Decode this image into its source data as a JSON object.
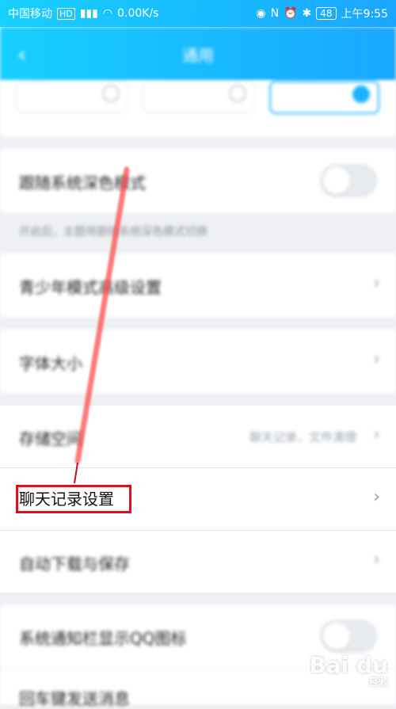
{
  "status_bar": {
    "carrier": "中国移动",
    "hd": "HD",
    "speed": "0.00K/s",
    "battery": "48",
    "time": "上午9:55"
  },
  "header": {
    "title": "通用",
    "back_icon": "chevron-left-icon"
  },
  "settings": {
    "dark_mode_follow": {
      "label": "跟随系统深色模式"
    },
    "dark_mode_hint": "开启后，主题将跟随系统深色模式切换",
    "youth_mode": {
      "label": "青少年模式高级设置"
    },
    "font_size": {
      "label": "字体大小"
    },
    "storage": {
      "label": "存储空间",
      "value": "聊天记录，文件清理"
    },
    "chat_history": {
      "label": "聊天记录设置"
    },
    "auto_download": {
      "label": "自动下载与保存"
    },
    "system_notify_icon": {
      "label": "系统通知栏显示QQ图标"
    },
    "enter_send": {
      "label": "回车键发送消息"
    }
  },
  "watermark": {
    "text": "Bai du",
    "sub": "经验"
  },
  "colors": {
    "accent": "#1aa6ff",
    "highlight": "#e10d1a",
    "arrow": "#ff4d4f"
  }
}
